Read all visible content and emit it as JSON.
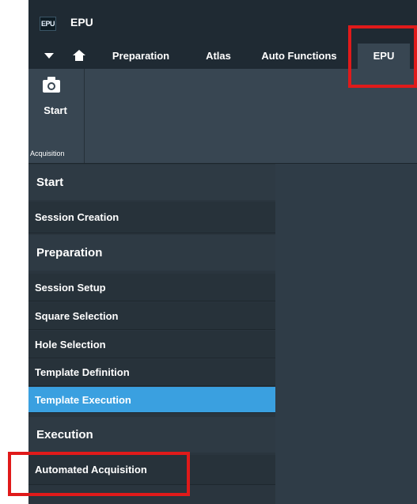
{
  "app": {
    "logo_text": "EPU",
    "title": "EPU"
  },
  "tabs": [
    {
      "label": "Preparation"
    },
    {
      "label": "Atlas"
    },
    {
      "label": "Auto Functions"
    },
    {
      "label": "EPU"
    }
  ],
  "ribbon": {
    "start_label": "Start",
    "group_label": "Acquisition",
    "icon": "camera-icon"
  },
  "panel": {
    "sections": [
      {
        "title": "Start",
        "items": [
          "Session Creation"
        ]
      },
      {
        "title": "Preparation",
        "items": [
          "Session Setup",
          "Square Selection",
          "Hole Selection",
          "Template Definition",
          "Template Execution"
        ]
      },
      {
        "title": "Execution",
        "items": [
          "Automated Acquisition"
        ]
      }
    ],
    "selected_item": "Template Execution"
  },
  "colors": {
    "background": "#2e3a44",
    "titlebar": "#1f2a33",
    "selected": "#3aa0e0",
    "highlight": "#e01a1a"
  }
}
